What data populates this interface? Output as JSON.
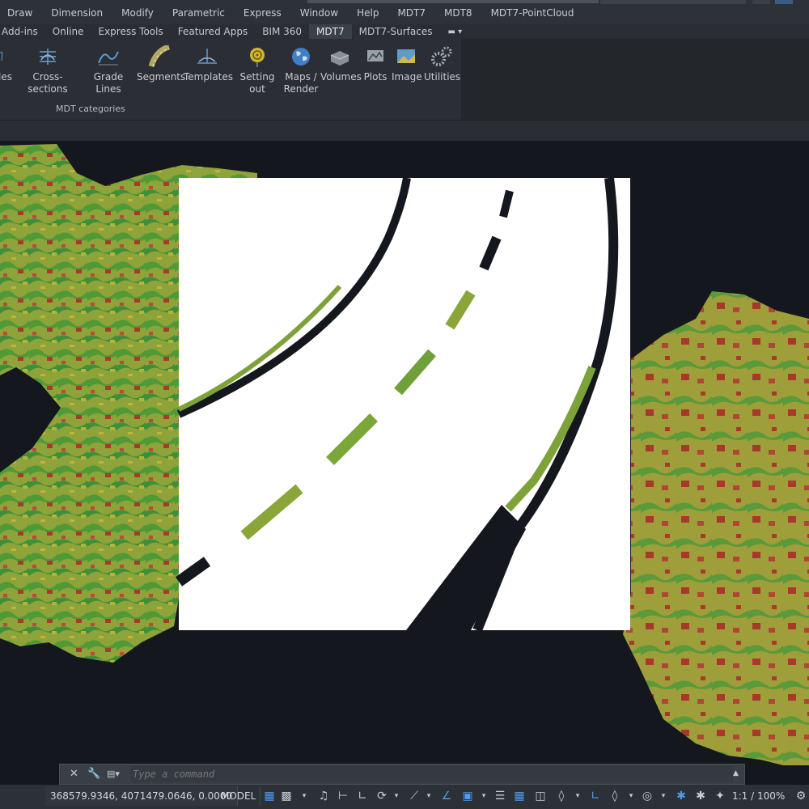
{
  "menu": [
    "Draw",
    "Dimension",
    "Modify",
    "Parametric",
    "Express",
    "Window",
    "Help",
    "MDT7",
    "MDT8",
    "MDT7-PointCloud"
  ],
  "tabs": [
    "Add-ins",
    "Online",
    "Express Tools",
    "Featured Apps",
    "BIM 360",
    "MDT7",
    "MDT7-Surfaces"
  ],
  "active_tab": "MDT7",
  "ribbon": {
    "items": [
      {
        "label": "les",
        "icon": "profiles-icon"
      },
      {
        "label": "Cross-sections",
        "icon": "cross-sections-icon"
      },
      {
        "label": "Grade Lines",
        "icon": "grade-lines-icon"
      },
      {
        "label": "Segments",
        "icon": "segments-icon"
      },
      {
        "label": "Templates",
        "icon": "templates-icon"
      },
      {
        "label": "Setting out",
        "icon": "setting-out-icon"
      },
      {
        "label": "Maps /",
        "label2": "Render",
        "icon": "globe-icon"
      },
      {
        "label": "Volumes",
        "icon": "volumes-icon"
      },
      {
        "label": "Plots",
        "icon": "plots-icon"
      },
      {
        "label": "Image",
        "icon": "image-icon"
      },
      {
        "label": "Utilities",
        "icon": "gears-icon"
      }
    ],
    "panel_label": "MDT categories"
  },
  "command": {
    "placeholder": "Type a command"
  },
  "status": {
    "coords": "368579.9346, 4071479.0646, 0.0000",
    "model": "MODEL",
    "scale": "1:1 / 100%"
  },
  "colors": {
    "accent": "#4f9bea",
    "background": "#14171d",
    "terrain_green": "#5aa63a",
    "terrain_red": "#a8382c",
    "terrain_yellow": "#b7b236"
  }
}
